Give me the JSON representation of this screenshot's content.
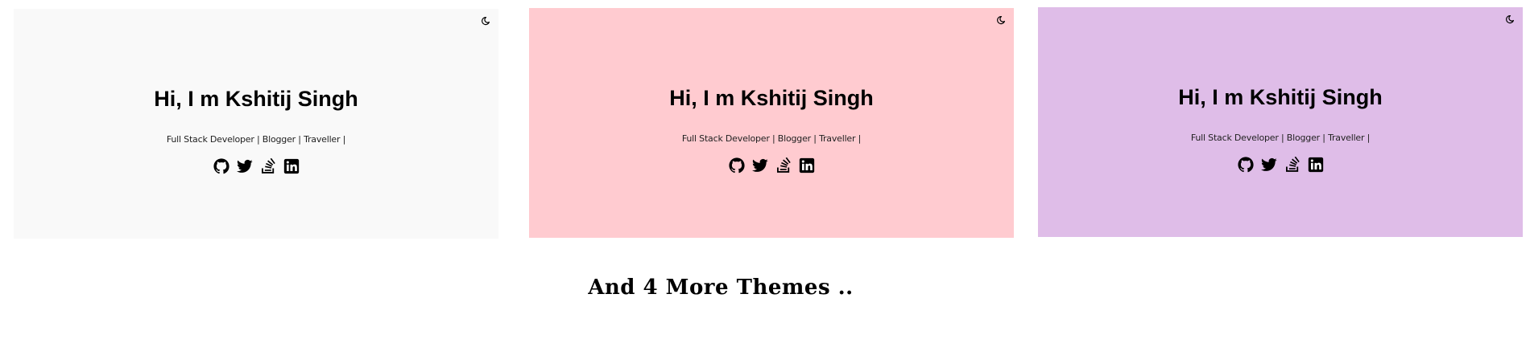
{
  "themes": [
    {
      "id": "light",
      "background": "#f9f9f9",
      "title": "Hi, I m Kshitij Singh",
      "subtitle": "Full Stack Developer | Blogger | Traveller |",
      "toggle_icon": "moon-icon",
      "social": [
        "github-icon",
        "twitter-icon",
        "stackoverflow-icon",
        "linkedin-icon"
      ]
    },
    {
      "id": "pink",
      "background": "#ffcbd0",
      "title": "Hi, I m Kshitij Singh",
      "subtitle": "Full Stack Developer | Blogger | Traveller |",
      "toggle_icon": "moon-icon",
      "social": [
        "github-icon",
        "twitter-icon",
        "stackoverflow-icon",
        "linkedin-icon"
      ]
    },
    {
      "id": "purple",
      "background": "#dfbde8",
      "title": "Hi, I m Kshitij Singh",
      "subtitle": "Full Stack Developer | Blogger | Traveller |",
      "toggle_icon": "moon-icon",
      "social": [
        "github-icon",
        "twitter-icon",
        "stackoverflow-icon",
        "linkedin-icon"
      ]
    }
  ],
  "footer": {
    "text": "And 4 More Themes .."
  }
}
